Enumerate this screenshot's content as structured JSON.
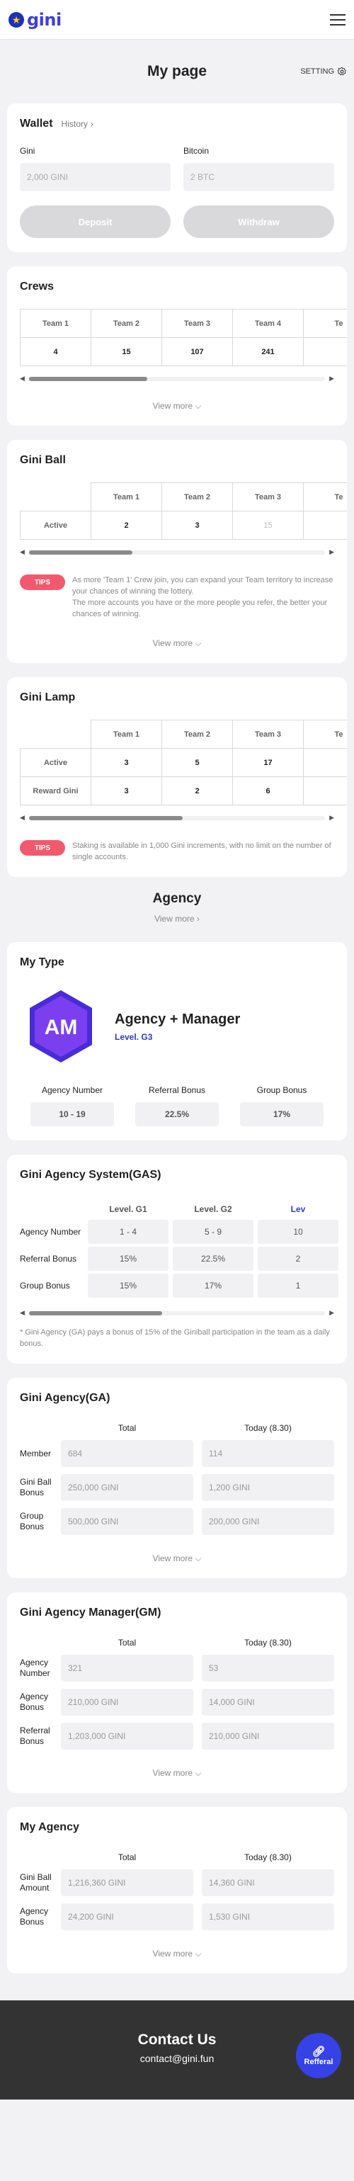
{
  "header": {
    "logo_text": "gini",
    "logo_icon": "star-icon",
    "menu_icon": "hamburger-icon"
  },
  "page": {
    "title": "My page",
    "setting_label": "SETTING",
    "setting_icon": "gear-icon"
  },
  "wallet": {
    "title": "Wallet",
    "history_label": "History",
    "gini_label": "Gini",
    "gini_value": "2,000 GINI",
    "bitcoin_label": "Bitcoin",
    "bitcoin_value": "2 BTC",
    "deposit_label": "Deposit",
    "withdraw_label": "Withdraw"
  },
  "crews": {
    "title": "Crews",
    "headers": [
      "Team 1",
      "Team 2",
      "Team 3",
      "Team 4",
      "Te"
    ],
    "values": [
      "4",
      "15",
      "107",
      "241",
      ""
    ],
    "scroll_position": 0.4,
    "view_more": "View more"
  },
  "gini_ball": {
    "title": "Gini Ball",
    "headers": [
      "Team 1",
      "Team 2",
      "Team 3",
      "Te"
    ],
    "row_label": "Active",
    "values": [
      "2",
      "3",
      "15",
      ""
    ],
    "scroll_position": 0.35,
    "tips_label": "TIPS",
    "tips_text": "As more 'Team 1' Crew join, you can expand your Team territory to increase your chances of winning the lottery.",
    "tips_text2": "The more accounts you have or the more people you refer, the better your chances of winning.",
    "view_more": "View more"
  },
  "gini_lamp": {
    "title": "Gini Lamp",
    "headers": [
      "Team 1",
      "Team 2",
      "Team 3",
      "Te"
    ],
    "rows": [
      {
        "label": "Active",
        "values": [
          "3",
          "5",
          "17",
          ""
        ]
      },
      {
        "label": "Reward Gini",
        "values": [
          "3",
          "2",
          "6",
          ""
        ]
      }
    ],
    "scroll_position": 0.52,
    "tips_label": "TIPS",
    "tips_text": "Staking is available in 1,000 Gini increments, with no limit on the number of single accounts."
  },
  "agency": {
    "title": "Agency",
    "view_more": "View more"
  },
  "my_type": {
    "title": "My Type",
    "badge_text": "AM",
    "type_name": "Agency + Manager",
    "level": "Level. G3",
    "stats": [
      {
        "label": "Agency Number",
        "value": "10 - 19"
      },
      {
        "label": "Referral Bonus",
        "value": "22.5%"
      },
      {
        "label": "Group Bonus",
        "value": "17%"
      }
    ],
    "colors": {
      "badge_outer": "#4a2bd8",
      "badge_inner": "#7b3ff0",
      "level": "#3036d9"
    }
  },
  "gas": {
    "title": "Gini Agency System(GAS)",
    "columns": [
      "Level. G1",
      "Level. G2",
      "Lev"
    ],
    "rows": [
      {
        "label": "Agency Number",
        "values": [
          "1 - 4",
          "5 - 9",
          "10"
        ]
      },
      {
        "label": "Referral Bonus",
        "values": [
          "15%",
          "22.5%",
          "2"
        ]
      },
      {
        "label": "Group Bonus",
        "values": [
          "15%",
          "17%",
          "1"
        ]
      }
    ],
    "scroll_position": 0.45,
    "note": "* Gini Agency (GA) pays a bonus of 15% of the Giniball participation in the team as a daily bonus."
  },
  "ga": {
    "title": "Gini Agency(GA)",
    "col_total": "Total",
    "col_today": "Today (8.30)",
    "rows": [
      {
        "label": "Member",
        "total": "684",
        "today": "114"
      },
      {
        "label": "Gini Ball Bonus",
        "total": "250,000 GINI",
        "today": "1,200 GINI"
      },
      {
        "label": "Group Bonus",
        "total": "500,000 GINI",
        "today": "200,000 GINI"
      }
    ],
    "view_more": "View more"
  },
  "gm": {
    "title": "Gini Agency Manager(GM)",
    "col_total": "Total",
    "col_today": "Today (8.30)",
    "rows": [
      {
        "label": "Agency Number",
        "total": "321",
        "today": "53"
      },
      {
        "label": "Agency Bonus",
        "total": "210,000 GINI",
        "today": "14,000 GINI"
      },
      {
        "label": "Referral Bonus",
        "total": "1,203,000 GINI",
        "today": "210,000 GINI"
      }
    ],
    "view_more": "View more"
  },
  "my_agency": {
    "title": "My Agency",
    "col_total": "Total",
    "col_today": "Today (8.30)",
    "rows": [
      {
        "label": "Gini Ball Amount",
        "total": "1,216,360 GINI",
        "today": "14,360 GINI"
      },
      {
        "label": "Agency Bonus",
        "total": "24,200 GINI",
        "today": "1,530 GINI"
      }
    ],
    "view_more": "View more"
  },
  "footer": {
    "title": "Contact Us",
    "email": "contact@gini.fun",
    "referral_label": "Refferal",
    "referral_icon": "link-icon"
  },
  "colors": {
    "accent": "#3442e6",
    "tips": "#f15a6e",
    "footer_bg": "#333333",
    "button_disabled": "#d9d9db"
  }
}
